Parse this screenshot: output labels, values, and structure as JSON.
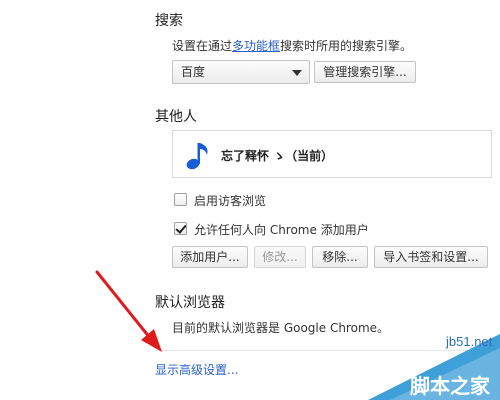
{
  "search": {
    "heading": "搜索",
    "desc_before": "设置在通过",
    "desc_link": "多功能框",
    "desc_after": "搜索时所用的搜索引擎。",
    "engine_selected": "百度",
    "manage_button": "管理搜索引擎..."
  },
  "people": {
    "heading": "其他人",
    "profile_name": "忘了释怀 ゝ（当前）",
    "guest_label": "启用访客浏览",
    "guest_checked": false,
    "allow_add_label": "允许任何人向 Chrome 添加用户",
    "allow_add_checked": true,
    "buttons": {
      "add": "添加用户...",
      "edit": "修改...",
      "remove": "移除...",
      "import": "导入书签和设置..."
    }
  },
  "default_browser": {
    "heading": "默认浏览器",
    "desc": "目前的默认浏览器是 Google Chrome。"
  },
  "advanced_link": "显示高级设置...",
  "watermark": {
    "site": "jb51.net",
    "text": "脚本之家"
  },
  "colors": {
    "link": "#2a61c9",
    "arrow": "#e01b1b",
    "avatar_note": "#1a5bd6"
  }
}
